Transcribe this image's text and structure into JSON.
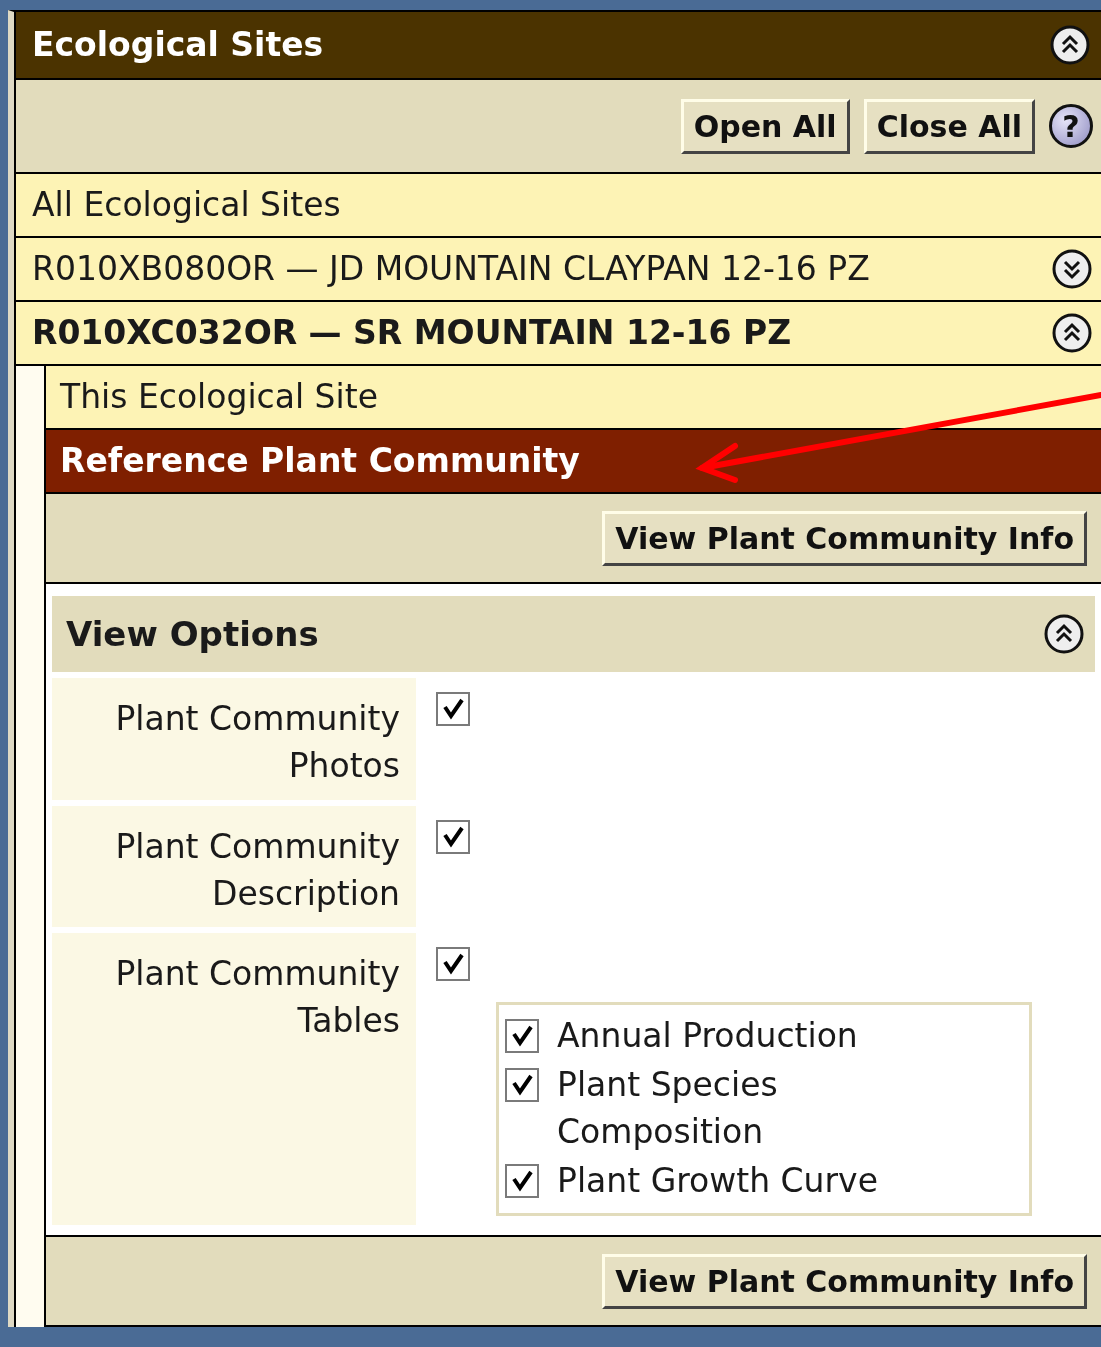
{
  "panel": {
    "title": "Ecological Sites",
    "expanded": true
  },
  "toolbar": {
    "buttons": [
      "Open All",
      "Close All"
    ],
    "help": "?"
  },
  "sites": [
    {
      "kind": "all",
      "label": "All Ecological Sites"
    },
    {
      "kind": "site",
      "label": "R010XB080OR — JD MOUNTAIN CLAYPAN 12-16 PZ",
      "expanded": false
    },
    {
      "kind": "site",
      "label": "R010XC032OR — SR MOUNTAIN 12-16 PZ",
      "expanded": true
    }
  ],
  "site_detail": {
    "items": [
      {
        "label": "This Ecological Site",
        "selected": false
      },
      {
        "label": "Reference Plant Community",
        "selected": true
      }
    ],
    "top_button": "View Plant Community Info",
    "view_options": {
      "title": "View Options",
      "expanded": true,
      "options": [
        {
          "label": "Plant Community Photos",
          "checked": true
        },
        {
          "label": "Plant Community Description",
          "checked": true
        },
        {
          "label": "Plant Community Tables",
          "checked": true,
          "suboptions": [
            {
              "label": "Annual Production",
              "checked": true
            },
            {
              "label": "Plant Species Composition",
              "checked": true
            },
            {
              "label": "Plant Growth Curve",
              "checked": true
            }
          ]
        }
      ]
    },
    "bottom_button": "View Plant Community Info"
  }
}
